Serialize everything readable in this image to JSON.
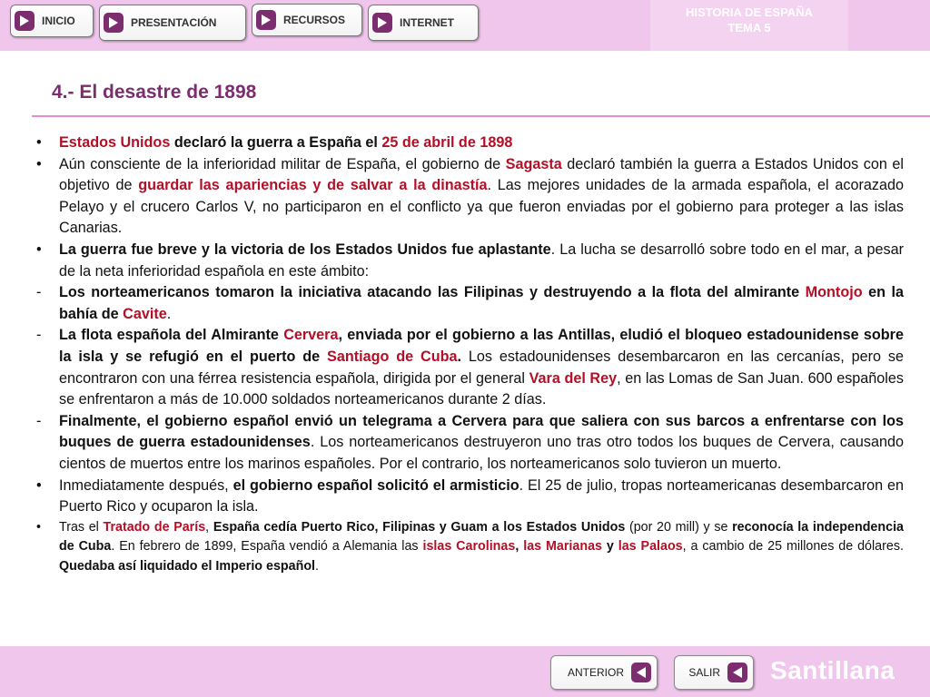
{
  "nav": {
    "inicio": "INICIO",
    "presentacion": "PRESENTACIÓN",
    "recursos": "RECURSOS",
    "internet": "INTERNET"
  },
  "header": {
    "subject": "HISTORIA DE ESPAÑA",
    "unit": "TEMA 5"
  },
  "title": "4.- El desastre de 1898",
  "footer": {
    "anterior": "ANTERIOR",
    "salir": "SALIR",
    "logo": "Santillana"
  },
  "colors": {
    "bar": "#f0c6ec",
    "accent": "#7b2d6f",
    "highlight": "#b30f26"
  },
  "icons": {
    "nav": "play-icon",
    "footer": "back-arrow-icon"
  },
  "items": [
    {
      "marker": "•",
      "size": "normal",
      "runs": [
        {
          "s": "r",
          "t": "Estados Unidos"
        },
        {
          "s": "b",
          "t": " declaró la guerra a España el "
        },
        {
          "s": "r",
          "t": "25 de abril de 1898"
        }
      ]
    },
    {
      "marker": "•",
      "size": "normal",
      "runs": [
        {
          "s": "n",
          "t": "Aún consciente de la inferioridad militar de España, el gobierno de "
        },
        {
          "s": "r",
          "t": "Sagasta"
        },
        {
          "s": "n",
          "t": " declaró también la guerra a Estados Unidos con el objetivo de "
        },
        {
          "s": "r",
          "t": "guardar las apariencias y de salvar a la dinastía"
        },
        {
          "s": "n",
          "t": ". Las mejores unidades de la armada española, el acorazado Pelayo y el crucero Carlos V, no participaron en el conflicto ya que fueron enviadas por el gobierno para proteger a las islas Canarias."
        }
      ]
    },
    {
      "marker": "•",
      "size": "normal",
      "runs": [
        {
          "s": "b",
          "t": "La guerra fue breve y la victoria de los Estados Unidos fue aplastante"
        },
        {
          "s": "n",
          "t": ". La lucha se desarrolló sobre todo en el mar, a pesar de la neta inferioridad española en este ámbito:"
        }
      ]
    },
    {
      "marker": "-",
      "size": "normal",
      "runs": [
        {
          "s": "b",
          "t": "Los norteamericanos tomaron la iniciativa atacando las Filipinas y destruyendo a la flota del almirante "
        },
        {
          "s": "r",
          "t": "Montojo"
        },
        {
          "s": "b",
          "t": " en la bahía de "
        },
        {
          "s": "r",
          "t": "Cavite"
        },
        {
          "s": "n",
          "t": "."
        }
      ]
    },
    {
      "marker": "-",
      "size": "normal",
      "runs": [
        {
          "s": "b",
          "t": "La flota española del Almirante "
        },
        {
          "s": "r",
          "t": "Cervera"
        },
        {
          "s": "b",
          "t": ", enviada por el gobierno a las Antillas, eludió el bloqueo estadounidense sobre la isla y se refugió en el puerto de "
        },
        {
          "s": "r",
          "t": "Santiago de Cuba"
        },
        {
          "s": "b",
          "t": "."
        },
        {
          "s": "n",
          "t": " Los estadounidenses desembarcaron en las cercanías, pero se encontraron con una férrea resistencia española, dirigida por el general "
        },
        {
          "s": "r",
          "t": "Vara del Rey"
        },
        {
          "s": "n",
          "t": ", en las Lomas de San Juan. 600 españoles se enfrentaron a más de 10.000 soldados norteamericanos durante 2 días."
        }
      ]
    },
    {
      "marker": "-",
      "size": "normal",
      "runs": [
        {
          "s": "b",
          "t": "Finalmente, el gobierno español envió un telegrama a Cervera para que saliera con sus barcos a enfrentarse con los buques de guerra estadounidenses"
        },
        {
          "s": "n",
          "t": ". Los norteamericanos destruyeron uno tras otro todos los buques de Cervera, causando cientos de muertos entre los marinos españoles. Por el contrario, los norteamericanos solo tuvieron un muerto."
        }
      ]
    },
    {
      "marker": "•",
      "size": "normal",
      "runs": [
        {
          "s": "n",
          "t": "Inmediatamente después, "
        },
        {
          "s": "b",
          "t": "el gobierno español solicitó el armisticio"
        },
        {
          "s": "n",
          "t": ". El 25 de julio, tropas norteamericanas desembarcaron en Puerto Rico y ocuparon la isla."
        }
      ]
    },
    {
      "marker": "•",
      "size": "small",
      "runs": [
        {
          "s": "n",
          "t": "Tras el "
        },
        {
          "s": "r",
          "t": "Tratado de París"
        },
        {
          "s": "n",
          "t": ", "
        },
        {
          "s": "b",
          "t": "España cedía Puerto Rico, Filipinas y Guam a los Estados Unidos"
        },
        {
          "s": "n",
          "t": " (por 20 mill) y se "
        },
        {
          "s": "b",
          "t": "reconocía la independencia de Cuba"
        },
        {
          "s": "n",
          "t": ". En febrero de 1899, España vendió a Alemania las "
        },
        {
          "s": "r",
          "t": "islas Carolinas"
        },
        {
          "s": "b",
          "t": ","
        },
        {
          "s": "n",
          "t": " "
        },
        {
          "s": "r",
          "t": "las Marianas"
        },
        {
          "s": "b",
          "t": " y "
        },
        {
          "s": "r",
          "t": "las Palaos"
        },
        {
          "s": "n",
          "t": ", a cambio de 25 millones de dólares. "
        },
        {
          "s": "b",
          "t": "Quedaba así liquidado el Imperio español"
        },
        {
          "s": "n",
          "t": "."
        }
      ]
    }
  ]
}
